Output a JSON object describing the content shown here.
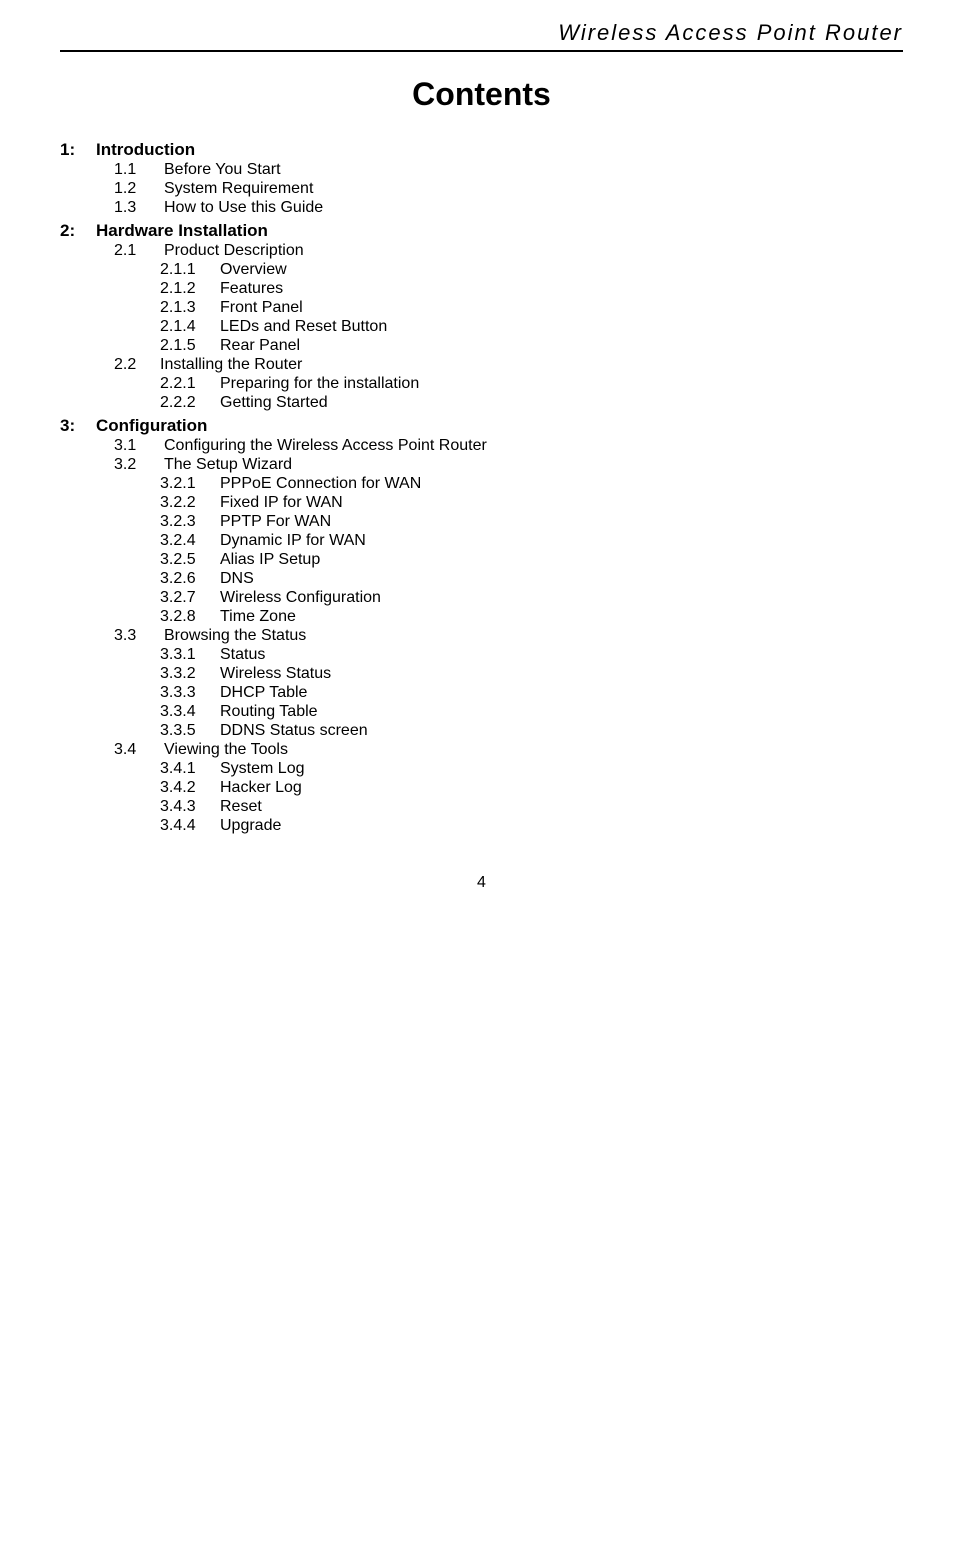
{
  "header": {
    "title": "Wireless  Access  Point  Router"
  },
  "page_title": "Contents",
  "sections": [
    {
      "num": "1:",
      "label": "Introduction",
      "children": [
        {
          "num": "1.1",
          "label": "Before You Start",
          "children": []
        },
        {
          "num": "1.2",
          "label": "System Requirement",
          "children": []
        },
        {
          "num": "1.3",
          "label": "How to Use this Guide",
          "children": []
        }
      ]
    },
    {
      "num": "2:",
      "label": "Hardware Installation",
      "children": [
        {
          "num": "2.1",
          "label": "Product Description",
          "children": [
            {
              "num": "2.1.1",
              "label": "Overview"
            },
            {
              "num": "2.1.2",
              "label": "Features"
            },
            {
              "num": "2.1.3",
              "label": "Front Panel"
            },
            {
              "num": "2.1.4",
              "label": "LEDs and Reset Button"
            },
            {
              "num": "2.1.5",
              "label": "Rear Panel"
            }
          ]
        },
        {
          "num": "2.2",
          "label": "Installing the Router",
          "children": [
            {
              "num": "2.2.1",
              "label": "Preparing for the installation"
            },
            {
              "num": "2.2.2",
              "label": "Getting Started"
            }
          ]
        }
      ]
    },
    {
      "num": "3:",
      "label": "Configuration",
      "children": [
        {
          "num": "3.1",
          "label": "Configuring the Wireless Access Point Router",
          "children": []
        },
        {
          "num": "3.2",
          "label": "The Setup Wizard",
          "children": [
            {
              "num": "3.2.1",
              "label": "PPPoE Connection for WAN"
            },
            {
              "num": "3.2.2",
              "label": "Fixed IP for WAN"
            },
            {
              "num": "3.2.3",
              "label": "PPTP For WAN"
            },
            {
              "num": "3.2.4",
              "label": "Dynamic IP for WAN"
            },
            {
              "num": "3.2.5",
              "label": "Alias IP Setup"
            },
            {
              "num": "3.2.6",
              "label": "DNS"
            },
            {
              "num": "3.2.7",
              "label": "Wireless Configuration"
            },
            {
              "num": "3.2.8",
              "label": "Time Zone"
            }
          ]
        },
        {
          "num": "3.3",
          "label": "Browsing the Status",
          "children": [
            {
              "num": "3.3.1",
              "label": "Status"
            },
            {
              "num": "3.3.2",
              "label": "Wireless Status"
            },
            {
              "num": "3.3.3",
              "label": "DHCP Table"
            },
            {
              "num": "3.3.4",
              "label": "Routing Table"
            },
            {
              "num": "3.3.5",
              "label": "DDNS Status screen"
            }
          ]
        },
        {
          "num": "3.4",
          "label": "Viewing the Tools",
          "children": [
            {
              "num": "3.4.1",
              "label": "System Log"
            },
            {
              "num": "3.4.2",
              "label": "Hacker Log"
            },
            {
              "num": "3.4.3",
              "label": "Reset"
            },
            {
              "num": "3.4.4",
              "label": "Upgrade"
            }
          ]
        }
      ]
    }
  ],
  "page_number": "4"
}
